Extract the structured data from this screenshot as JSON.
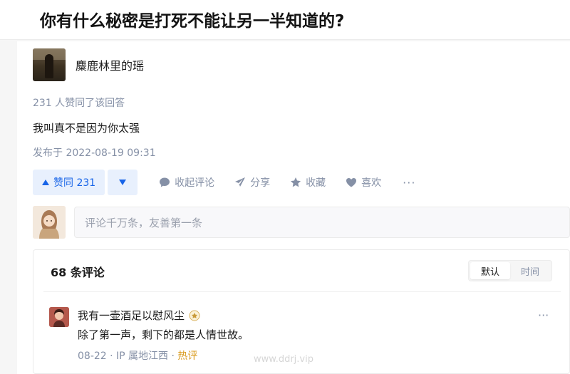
{
  "question": {
    "title": "你有什么秘密是打死不能让另一半知道的?"
  },
  "answer": {
    "author_name": "麋鹿林里的瑶",
    "upvote_info": "231 人赞同了该回答",
    "content": "我叫真不是因为你太强",
    "published": "发布于 2022-08-19 09:31"
  },
  "actions": {
    "upvote_label": "赞同 231",
    "collapse_comments": "收起评论",
    "share": "分享",
    "favorite": "收藏",
    "like": "喜欢",
    "more": "···"
  },
  "comment_input": {
    "placeholder": "评论千万条，友善第一条"
  },
  "comments": {
    "count_label": "68 条评论",
    "sort_default": "默认",
    "sort_time": "时间",
    "items": [
      {
        "author": "我有一壶酒足以慰风尘",
        "text": "除了第一声，剩下的都是人情世故。",
        "meta": "08-22 · IP 属地江西 · ",
        "hot": "热评",
        "more": "···"
      }
    ]
  },
  "watermark": "www.ddrj.vip",
  "colors": {
    "accent_blue": "#1764e8",
    "vote_bg": "#e8f0fd",
    "muted": "#8590a6",
    "hot": "#d99a1b"
  }
}
